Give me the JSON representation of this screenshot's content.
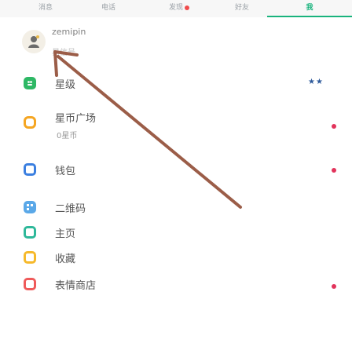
{
  "tabs": [
    {
      "label": "消息",
      "active": false,
      "dot": false
    },
    {
      "label": "电话",
      "active": false,
      "dot": false
    },
    {
      "label": "发现",
      "active": false,
      "dot": true
    },
    {
      "label": "好友",
      "active": false,
      "dot": false
    },
    {
      "label": "我",
      "active": true,
      "dot": false
    }
  ],
  "profile": {
    "name": "zemipin",
    "id_label": "易信号"
  },
  "menu": [
    {
      "label": "星级",
      "badge": "★★"
    },
    {
      "label": "星币广场",
      "sublabel": "0星币"
    },
    {
      "label": "钱包"
    },
    {
      "label": "二维码"
    },
    {
      "label": "主页"
    },
    {
      "label": "收藏"
    },
    {
      "label": "表情商店"
    }
  ],
  "colors": {
    "accent": "#19b37d",
    "badge_dot": "#e2335b",
    "arrow": "#9b5d48"
  }
}
